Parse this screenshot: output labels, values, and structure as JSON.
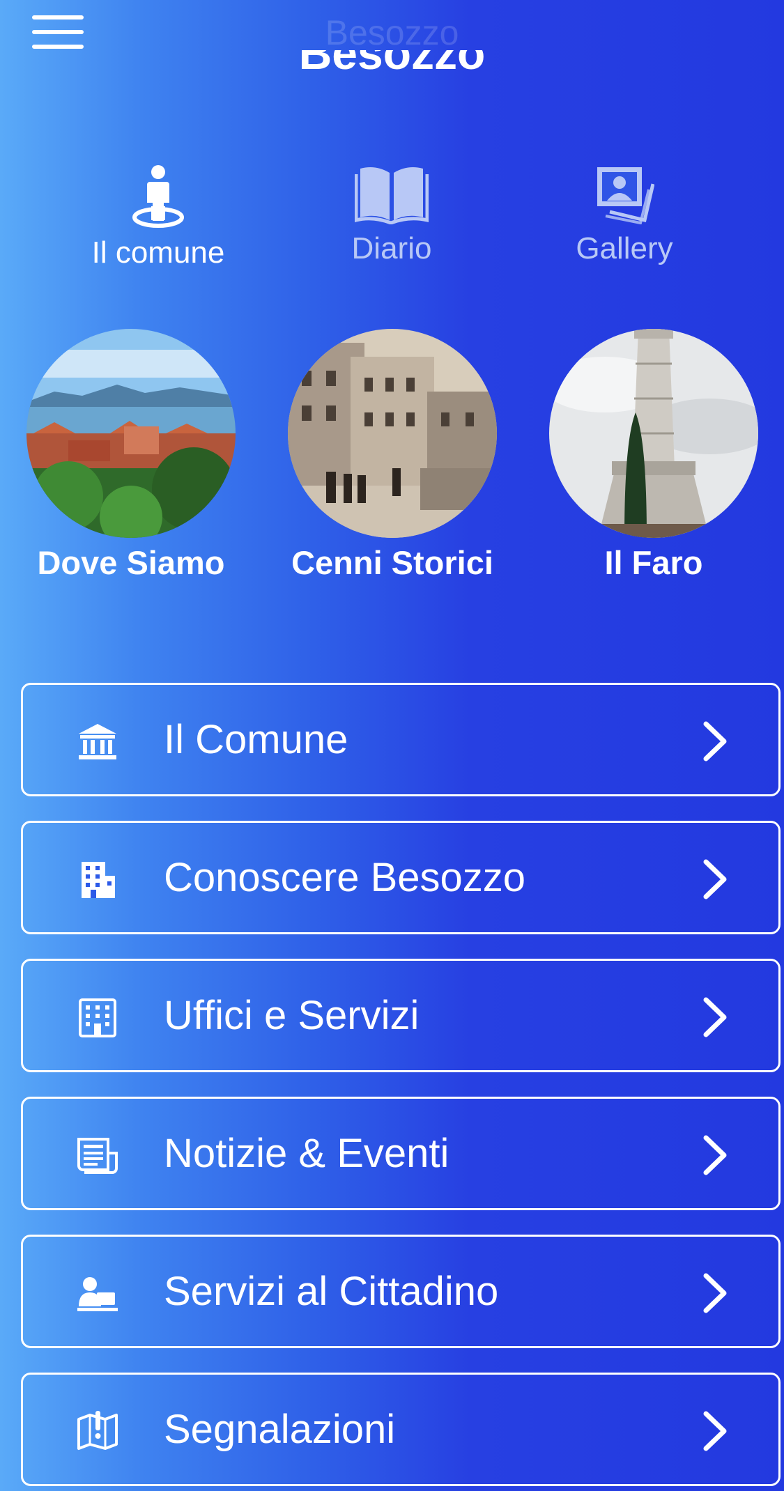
{
  "header": {
    "title": "Besozzo",
    "large_title": "Besozzo"
  },
  "tabs": [
    {
      "label": "Il comune",
      "icon": "person-location-icon",
      "active": true
    },
    {
      "label": "Diario",
      "icon": "open-book-icon",
      "active": false
    },
    {
      "label": "Gallery",
      "icon": "photo-stack-icon",
      "active": false
    }
  ],
  "highlights": [
    {
      "label": "Dove Siamo"
    },
    {
      "label": "Cenni Storici"
    },
    {
      "label": "Il Faro"
    }
  ],
  "menu": [
    {
      "label": "Il Comune",
      "icon": "town-hall-icon"
    },
    {
      "label": "Conoscere Besozzo",
      "icon": "buildings-icon"
    },
    {
      "label": "Uffici e Servizi",
      "icon": "office-building-icon"
    },
    {
      "label": "Notizie & Eventi",
      "icon": "newspaper-icon"
    },
    {
      "label": "Servizi al Cittadino",
      "icon": "citizen-desk-icon"
    },
    {
      "label": "Segnalazioni",
      "icon": "map-alert-icon"
    }
  ],
  "colors": {
    "gradient_left": "#5aaaf8",
    "gradient_right": "#2339e0",
    "text": "#ffffff",
    "inactive_tab": "#b8c8f6"
  }
}
